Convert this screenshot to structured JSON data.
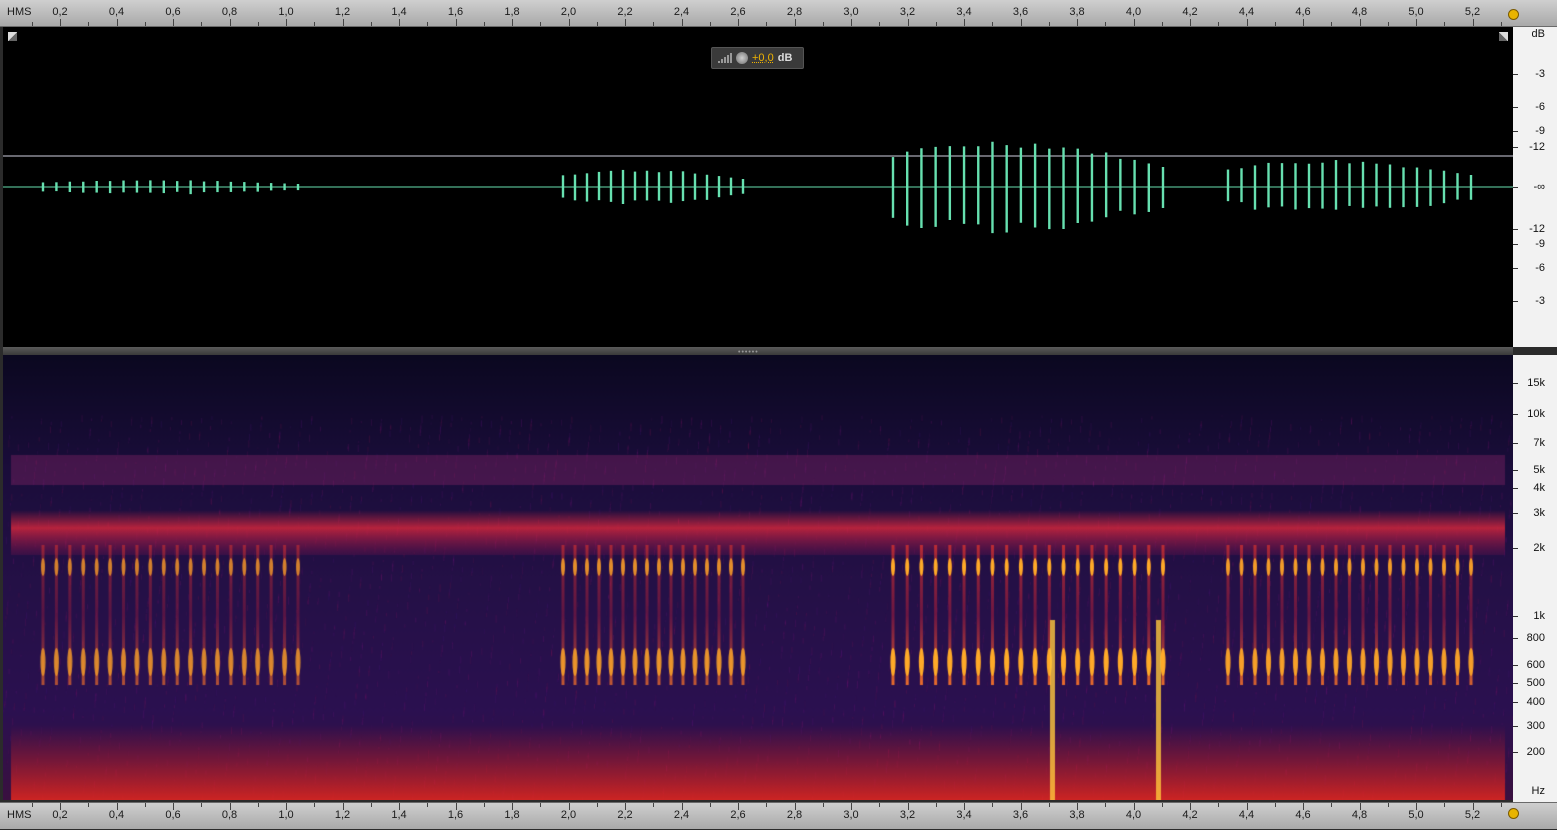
{
  "time_ruler": {
    "unit_label": "HMS",
    "labels": [
      "0,2",
      "0,4",
      "0,6",
      "0,8",
      "1,0",
      "1,2",
      "1,4",
      "1,6",
      "1,8",
      "2,0",
      "2,2",
      "2,4",
      "2,6",
      "2,8",
      "3,0",
      "3,2",
      "3,4",
      "3,6",
      "3,8",
      "4,0",
      "4,2",
      "4,4",
      "4,6",
      "4,8",
      "5,0",
      "5,2"
    ]
  },
  "amplitude_scale": {
    "unit": "dB",
    "labels": [
      "-3",
      "-6",
      "-9",
      "-12",
      "-∞",
      "-12",
      "-9",
      "-6",
      "-3"
    ]
  },
  "frequency_scale": {
    "unit": "Hz",
    "labels": [
      "15k",
      "10k",
      "7k",
      "5k",
      "4k",
      "3k",
      "2k",
      "1k",
      "800",
      "600",
      "500",
      "400",
      "300",
      "200"
    ]
  },
  "gain_control": {
    "value": "+0,0",
    "unit": "dB"
  },
  "colors": {
    "waveform": "#67e0b0",
    "background": "#000000",
    "spectro_bg": "#0a0618",
    "accent": "#e8b400"
  },
  "icons": {
    "gain_meter": "signal-bars-icon",
    "gain_knob": "knob-icon",
    "playhead": "playhead-handle-icon"
  }
}
